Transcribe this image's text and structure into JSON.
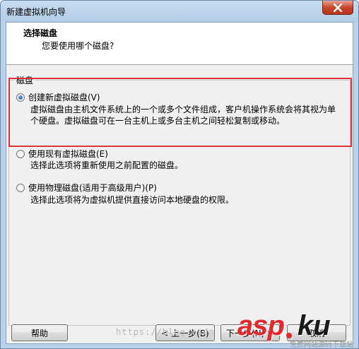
{
  "window": {
    "title": "新建虚拟机向导",
    "close_icon": "close-icon"
  },
  "header": {
    "title": "选择磁盘",
    "subtitle": "您要使用哪个磁盘?"
  },
  "group": {
    "legend": "磁盘"
  },
  "options": [
    {
      "label": "创建新虚拟磁盘(V)",
      "checked": true,
      "desc_line1": "虚拟磁盘由主机文件系统上的一个或多个文件组成，客户机操作系统会将其视为单",
      "desc_line2": "个硬盘。虚拟磁盘可在一台主机上或多台主机之间轻松复制或移动。"
    },
    {
      "label": "使用现有虚拟磁盘(E)",
      "checked": false,
      "desc_line1": "选择此选项将重新使用之前配置的磁盘。"
    },
    {
      "label": "使用物理磁盘(适用于高级用户)(P)",
      "checked": false,
      "desc_line1": "选择此选项将为虚拟机提供直接访问本地硬盘的权限。"
    }
  ],
  "buttons": {
    "help": "帮助",
    "back": "< 上一步(B)",
    "next": "下一步(N) >",
    "cancel": "取消"
  },
  "watermark": {
    "url": "https://blog.csdn",
    "asp": "asp",
    "ku": "ku",
    "tagline": "免费网站源码下载站",
    "brand_red": "#e5282d"
  },
  "colors": {
    "highlight": "#e0303a",
    "titlebar": "#b9d1ea",
    "client_bg": "#f0f0f0"
  }
}
